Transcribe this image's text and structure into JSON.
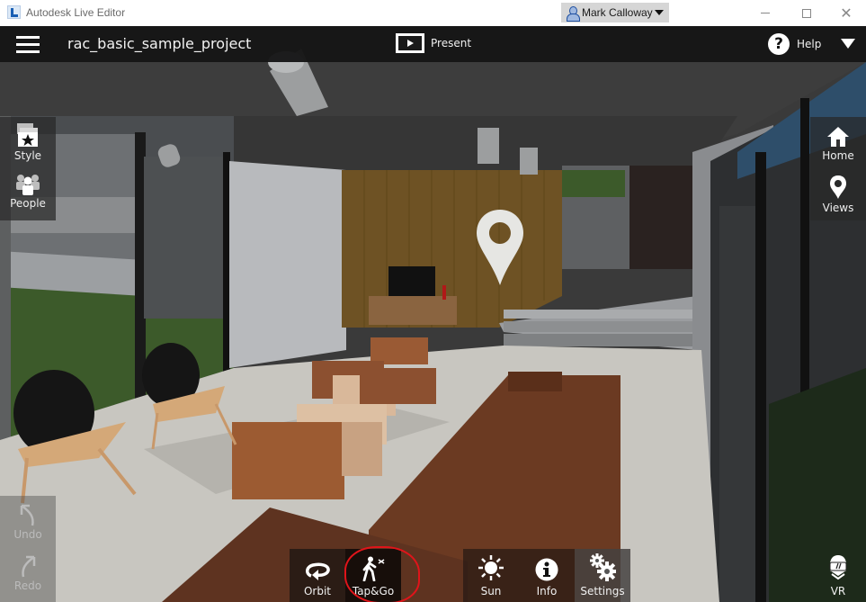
{
  "window": {
    "title": "Autodesk Live Editor",
    "user": "Mark Calloway",
    "controls": [
      "minimize",
      "maximize",
      "close"
    ]
  },
  "appbar": {
    "project_title": "rac_basic_sample_project",
    "present_label": "Present",
    "help_label": "Help"
  },
  "left_panel": {
    "items": [
      {
        "label": "Style",
        "icon": "style-star-icon"
      },
      {
        "label": "People",
        "icon": "people-icon"
      }
    ]
  },
  "right_panel": {
    "items": [
      {
        "label": "Home",
        "icon": "home-icon"
      },
      {
        "label": "Views",
        "icon": "location-pin-icon"
      }
    ]
  },
  "history_panel": {
    "items": [
      {
        "label": "Undo",
        "icon": "undo-arrow-icon",
        "enabled": false
      },
      {
        "label": "Redo",
        "icon": "redo-arrow-icon",
        "enabled": false
      }
    ]
  },
  "toolbar": {
    "navigation": [
      {
        "label": "Orbit",
        "icon": "orbit-icon",
        "active": false
      },
      {
        "label": "Tap&Go",
        "icon": "walk-icon",
        "active": true
      }
    ],
    "tools": [
      {
        "label": "Sun",
        "icon": "sun-icon"
      },
      {
        "label": "Info",
        "icon": "info-icon"
      },
      {
        "label": "Settings",
        "icon": "gears-icon"
      }
    ],
    "vr_label": "VR",
    "annotation": "red hand-drawn circle around Tap&Go"
  },
  "colors": {
    "appbar_bg": "#161616",
    "annotation_red": "#e0141a",
    "wood_wall": "#6e5224",
    "sofa_brown": "#6b3a22",
    "grass": "#3c5a2a",
    "floor": "#c8c6c0"
  }
}
